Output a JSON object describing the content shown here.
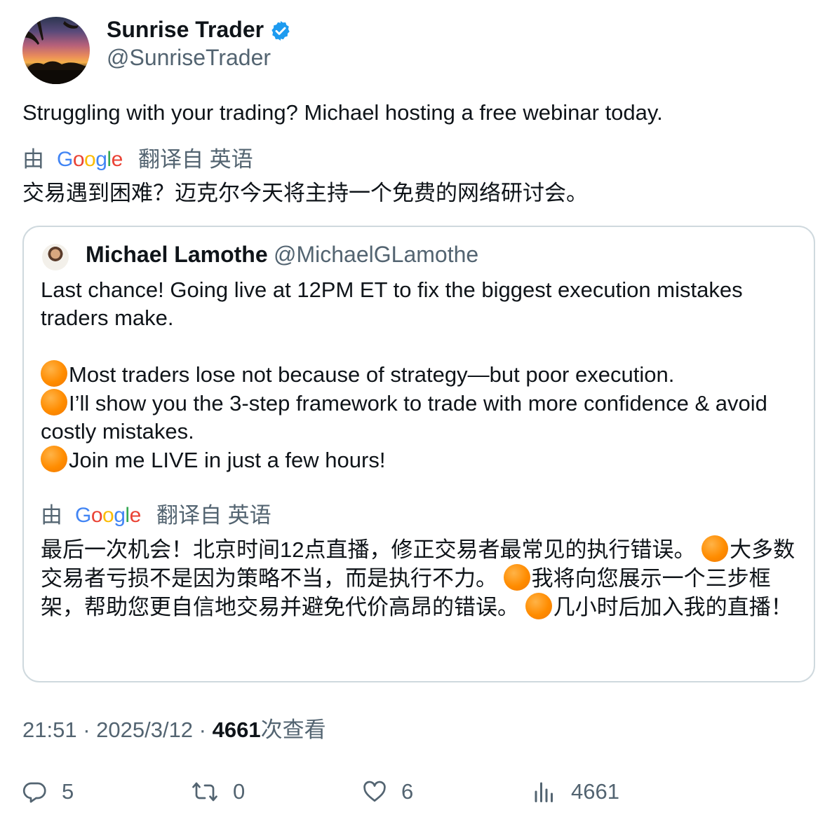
{
  "author": {
    "display_name": "Sunrise Trader",
    "handle": "@SunriseTrader",
    "verified_icon": "verified-badge-icon",
    "avatar": "sunset-landscape-avatar"
  },
  "tweet": {
    "text": "Struggling with your trading?  Michael hosting a free webinar today.",
    "translation": {
      "by": "由",
      "provider": "Google",
      "label": "翻译自 英语",
      "text": "交易遇到困难？迈克尔今天将主持一个免费的网络研讨会。"
    }
  },
  "quote": {
    "display_name": "Michael Lamothe",
    "handle": "@MichaelGLamothe",
    "lines": {
      "l1": "Last chance! Going live at 12PM ET to fix the biggest execution mistakes traders make.",
      "l2": "Most traders lose not because of strategy—but poor execution.",
      "l3": "I’ll show you the 3-step framework to trade with more confidence & avoid costly mistakes.",
      "l4": "Join me LIVE in just a few hours!"
    },
    "translation": {
      "by": "由",
      "provider": "Google",
      "label": "翻译自 英语",
      "p1": "最后一次机会！北京时间12点直播，修正交易者最常见的执行错误。 ",
      "p2": "大多数交易者亏损不是因为策略不当，而是执行不力。 ",
      "p3": "我将向您展示一个三步框架，帮助您更自信地交易并避免代价高昂的错误。 ",
      "p4": "几小时后加入我的直播！"
    }
  },
  "meta": {
    "time": "21:51",
    "sep": " · ",
    "date": "2025/3/12",
    "views_count": "4661",
    "views_label": "次查看"
  },
  "actions": {
    "replies": "5",
    "reposts": "0",
    "likes": "6",
    "views": "4661"
  },
  "colors": {
    "text": "#0f1419",
    "secondary": "#536471",
    "verified": "#1d9bf0",
    "border": "#cfd9de",
    "orange_dot": "#ff8c00"
  }
}
